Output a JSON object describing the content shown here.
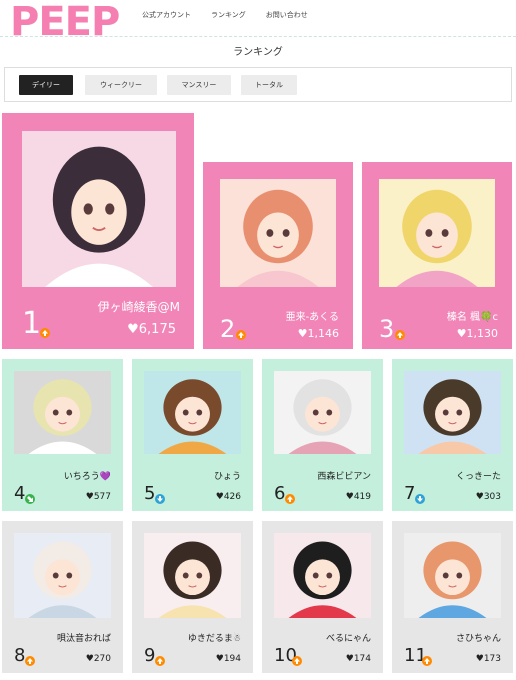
{
  "header": {
    "logo": "PEEP",
    "nav": [
      "公式アカウント",
      "ランキング",
      "お問い合わせ"
    ]
  },
  "page_title": "ランキング",
  "tabs": [
    {
      "label": "デイリー",
      "active": true
    },
    {
      "label": "ウィークリー",
      "active": false
    },
    {
      "label": "マンスリー",
      "active": false
    },
    {
      "label": "トータル",
      "active": false
    }
  ],
  "colors": {
    "pink": "#f285b8",
    "mint": "#c3efdc",
    "grey": "#e6e6e6",
    "logo": "#f47fb0",
    "up": "#ff8a00",
    "down": "#2fa3d6",
    "diag": "#38b24c"
  },
  "ranking": [
    {
      "rank": "1",
      "name": "伊ヶ崎綾香@M",
      "likes": "♥6,175",
      "trend": "up"
    },
    {
      "rank": "2",
      "name": "亜来-あくる",
      "likes": "♥1,146",
      "trend": "up"
    },
    {
      "rank": "3",
      "name": "榛名 楓🍀c",
      "likes": "♥1,130",
      "trend": "up"
    },
    {
      "rank": "4",
      "name": "いちろう💜",
      "likes": "♥577",
      "trend": "diag"
    },
    {
      "rank": "5",
      "name": "ひょう",
      "likes": "♥426",
      "trend": "down"
    },
    {
      "rank": "6",
      "name": "西森ビビアン",
      "likes": "♥419",
      "trend": "up"
    },
    {
      "rank": "7",
      "name": "くっきーた",
      "likes": "♥303",
      "trend": "down"
    },
    {
      "rank": "8",
      "name": "唄汰音おれば",
      "likes": "♥270",
      "trend": "up"
    },
    {
      "rank": "9",
      "name": "ゆきだるま☃",
      "likes": "♥194",
      "trend": "up"
    },
    {
      "rank": "10",
      "name": "べるにゃん",
      "likes": "♥174",
      "trend": "up"
    },
    {
      "rank": "11",
      "name": "さひちゃん",
      "likes": "♥173",
      "trend": "up"
    }
  ]
}
